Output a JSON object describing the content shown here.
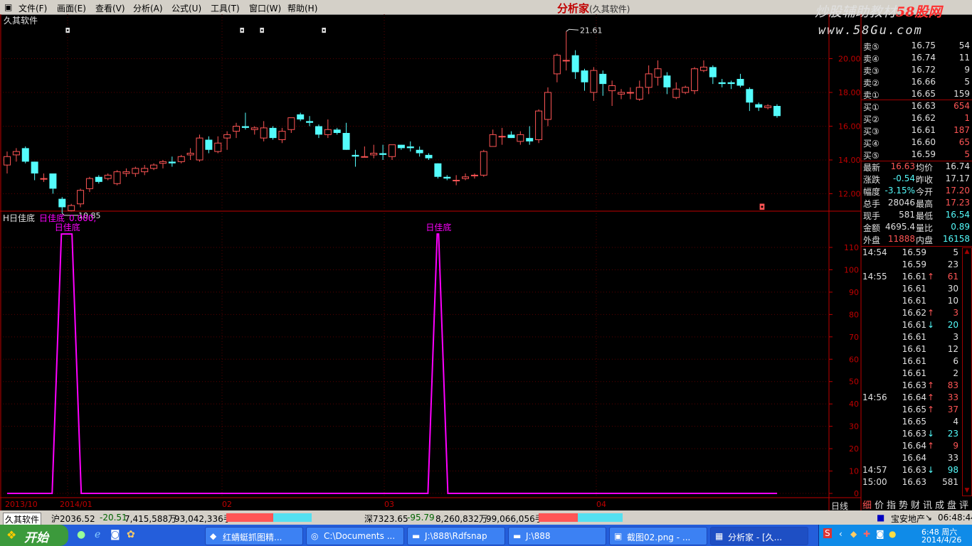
{
  "menu": {
    "items": [
      "文件(F)",
      "画面(E)",
      "查看(V)",
      "分析(A)",
      "公式(U)",
      "工具(T)",
      "窗口(W)",
      "帮助(H)"
    ],
    "app_name": "分析家",
    "app_vendor": "(久其软件)"
  },
  "ad": {
    "title_prefix": "炒股辅助教材",
    "title_brand": "58股网",
    "url": "www.58Gu.com"
  },
  "chart": {
    "stock_name": "久其软件",
    "price_axis_ticks": [
      "20.00",
      "18.00",
      "16.00",
      "14.00",
      "12.00"
    ],
    "high_label": "21.61",
    "low_label": "10.85",
    "indicator_title": "H日佳底",
    "indicator_series_label": "日佳底",
    "indicator_value": "0.000,",
    "signal_label": "日佳底",
    "indicator_axis_ticks": [
      "110",
      "100",
      "90",
      "80",
      "70",
      "60",
      "50",
      "40",
      "30",
      "20",
      "10",
      "0"
    ],
    "date_labels": [
      "2013/10",
      "2014/01",
      "02",
      "03",
      "04"
    ],
    "period": "日线",
    "marker_glyph": "◘",
    "colors": {
      "up": "#ff5555",
      "down": "#54fcfc",
      "indicator": "#ff00ff",
      "axis": "#c00000"
    }
  },
  "chart_data": [
    {
      "type": "candlestick",
      "title": "久其软件",
      "ylim": [
        11,
        22
      ],
      "high_mark": 21.61,
      "low_mark": 10.85,
      "candles": [
        [
          13.7,
          14.5,
          13.2,
          14.2
        ],
        [
          14.3,
          14.7,
          13.9,
          14.5
        ],
        [
          14.7,
          14.8,
          13.8,
          13.9
        ],
        [
          13.9,
          13.9,
          12.8,
          13.2
        ],
        [
          12.9,
          13.2,
          12.7,
          12.9
        ],
        [
          13.2,
          13.2,
          12.0,
          12.3
        ],
        [
          11.7,
          11.8,
          10.85,
          11.2
        ],
        [
          11.0,
          11.4,
          10.95,
          11.3
        ],
        [
          11.4,
          12.3,
          11.2,
          12.2
        ],
        [
          12.3,
          13.0,
          12.1,
          12.9
        ],
        [
          13.0,
          13.1,
          12.6,
          12.7
        ],
        [
          12.9,
          13.2,
          12.8,
          13.1
        ],
        [
          12.6,
          13.4,
          12.5,
          13.3
        ],
        [
          13.2,
          13.5,
          13.0,
          13.3
        ],
        [
          13.2,
          13.6,
          13.0,
          13.5
        ],
        [
          13.3,
          13.7,
          13.1,
          13.5
        ],
        [
          13.5,
          13.8,
          13.4,
          13.7
        ],
        [
          13.8,
          14.0,
          13.5,
          13.9
        ],
        [
          13.9,
          14.2,
          13.6,
          13.8
        ],
        [
          13.9,
          14.3,
          13.8,
          14.2
        ],
        [
          14.3,
          14.7,
          14.0,
          14.4
        ],
        [
          14.0,
          15.5,
          13.9,
          15.3
        ],
        [
          15.2,
          15.4,
          14.4,
          14.6
        ],
        [
          14.5,
          15.4,
          14.4,
          15.0
        ],
        [
          15.3,
          15.7,
          14.6,
          15.5
        ],
        [
          15.7,
          16.2,
          15.3,
          16.0
        ],
        [
          16.0,
          16.8,
          15.8,
          15.9
        ],
        [
          15.8,
          16.0,
          15.5,
          15.9
        ],
        [
          15.3,
          16.3,
          15.1,
          15.9
        ],
        [
          15.9,
          16.0,
          15.2,
          15.3
        ],
        [
          15.2,
          15.9,
          15.0,
          15.7
        ],
        [
          15.8,
          16.5,
          15.6,
          16.5
        ],
        [
          16.7,
          16.8,
          16.3,
          16.4
        ],
        [
          16.3,
          16.6,
          16.0,
          16.2
        ],
        [
          16.0,
          16.1,
          15.3,
          15.5
        ],
        [
          15.5,
          16.4,
          15.3,
          15.8
        ],
        [
          15.8,
          15.9,
          15.5,
          15.6
        ],
        [
          15.6,
          16.2,
          14.6,
          14.6
        ],
        [
          14.3,
          14.6,
          13.6,
          14.2
        ],
        [
          14.2,
          14.8,
          14.2,
          14.2
        ],
        [
          14.3,
          14.9,
          14.1,
          14.4
        ],
        [
          14.4,
          14.9,
          14.0,
          14.3
        ],
        [
          14.2,
          14.9,
          14.0,
          14.9
        ],
        [
          14.9,
          14.9,
          14.6,
          14.7
        ],
        [
          14.8,
          15.1,
          14.5,
          14.7
        ],
        [
          14.6,
          14.8,
          14.2,
          14.4
        ],
        [
          14.3,
          14.4,
          14.0,
          14.1
        ],
        [
          13.8,
          13.8,
          12.9,
          13.0
        ],
        [
          13.0,
          13.1,
          12.8,
          12.9
        ],
        [
          12.8,
          13.1,
          12.5,
          12.8
        ],
        [
          12.9,
          13.2,
          12.8,
          13.0
        ],
        [
          13.1,
          13.2,
          12.9,
          13.1
        ],
        [
          13.1,
          14.6,
          13.0,
          14.5
        ],
        [
          14.8,
          15.8,
          14.8,
          15.5
        ],
        [
          15.4,
          15.9,
          14.9,
          15.4
        ],
        [
          15.5,
          15.7,
          15.3,
          15.3
        ],
        [
          15.1,
          15.7,
          14.9,
          15.5
        ],
        [
          15.3,
          16.0,
          14.9,
          15.1
        ],
        [
          15.2,
          17.0,
          15.0,
          16.9
        ],
        [
          16.4,
          18.3,
          16.0,
          18.0
        ],
        [
          19.1,
          20.3,
          18.6,
          20.2
        ],
        [
          19.9,
          21.61,
          19.3,
          19.9
        ],
        [
          20.2,
          20.5,
          18.8,
          19.2
        ],
        [
          19.3,
          19.4,
          18.1,
          18.6
        ],
        [
          18.0,
          19.5,
          17.5,
          19.3
        ],
        [
          19.1,
          19.3,
          17.8,
          18.5
        ],
        [
          18.1,
          18.7,
          17.2,
          18.4
        ],
        [
          17.9,
          18.2,
          17.6,
          18.0
        ],
        [
          18.0,
          18.3,
          17.6,
          18.0
        ],
        [
          17.6,
          18.7,
          17.5,
          18.3
        ],
        [
          18.3,
          19.6,
          17.9,
          19.1
        ],
        [
          18.9,
          19.9,
          18.4,
          19.4
        ],
        [
          19.0,
          19.2,
          17.9,
          18.3
        ],
        [
          17.7,
          18.6,
          17.6,
          18.2
        ],
        [
          18.0,
          18.4,
          17.9,
          18.3
        ],
        [
          18.1,
          19.5,
          17.9,
          19.4
        ],
        [
          19.3,
          19.9,
          19.2,
          19.5
        ],
        [
          19.5,
          19.6,
          18.5,
          18.9
        ],
        [
          18.6,
          18.8,
          18.3,
          18.5
        ],
        [
          18.6,
          18.7,
          18.2,
          18.5
        ],
        [
          18.8,
          19.1,
          18.3,
          18.4
        ],
        [
          18.2,
          18.3,
          16.9,
          17.4
        ],
        [
          17.3,
          17.4,
          16.9,
          17.1
        ],
        [
          17.1,
          17.3,
          17.0,
          17.2
        ],
        [
          17.2,
          17.3,
          16.5,
          16.6
        ]
      ]
    },
    {
      "type": "line",
      "title": "H日佳底",
      "series": [
        {
          "name": "日佳底",
          "values": [
            0,
            0,
            0,
            0,
            0,
            0,
            116,
            116,
            0,
            0,
            0,
            0,
            0,
            0,
            0,
            0,
            0,
            0,
            0,
            0,
            0,
            0,
            0,
            0,
            0,
            0,
            0,
            0,
            0,
            0,
            0,
            0,
            0,
            0,
            0,
            0,
            0,
            0,
            0,
            0,
            0,
            0,
            0,
            0,
            0,
            0,
            0,
            116,
            0,
            0,
            0,
            0,
            0,
            0,
            0,
            0,
            0,
            0,
            0,
            0,
            0,
            0,
            0,
            0,
            0,
            0,
            0,
            0,
            0,
            0,
            0,
            0,
            0,
            0,
            0,
            0,
            0,
            0,
            0,
            0,
            0,
            0,
            0,
            0,
            0
          ]
        }
      ],
      "ylim": [
        0,
        120
      ],
      "signal_days": [
        6,
        7,
        47
      ]
    }
  ],
  "quote": {
    "asks": [
      {
        "label": "卖⑤",
        "price": "16.75",
        "vol": "54"
      },
      {
        "label": "卖④",
        "price": "16.74",
        "vol": "11"
      },
      {
        "label": "卖③",
        "price": "16.72",
        "vol": "9"
      },
      {
        "label": "卖②",
        "price": "16.66",
        "vol": "5"
      },
      {
        "label": "卖①",
        "price": "16.65",
        "vol": "159"
      }
    ],
    "bids": [
      {
        "label": "买①",
        "price": "16.63",
        "vol": "654"
      },
      {
        "label": "买②",
        "price": "16.62",
        "vol": "1"
      },
      {
        "label": "买③",
        "price": "16.61",
        "vol": "187"
      },
      {
        "label": "买④",
        "price": "16.60",
        "vol": "65"
      },
      {
        "label": "买⑤",
        "price": "16.59",
        "vol": "5"
      }
    ],
    "stats": [
      {
        "l1": "最新",
        "v1": "16.63",
        "c1": "#ff5555",
        "l2": "均价",
        "v2": "16.74",
        "c2": "#e0e0e0"
      },
      {
        "l1": "涨跌",
        "v1": "-0.54",
        "c1": "#54fcfc",
        "l2": "昨收",
        "v2": "17.17",
        "c2": "#e0e0e0"
      },
      {
        "l1": "幅度",
        "v1": "-3.15%",
        "c1": "#54fcfc",
        "l2": "今开",
        "v2": "17.20",
        "c2": "#ff5555"
      },
      {
        "l1": "总手",
        "v1": "28046",
        "c1": "#e0e0e0",
        "l2": "最高",
        "v2": "17.23",
        "c2": "#ff5555"
      },
      {
        "l1": "现手",
        "v1": "581",
        "c1": "#e0e0e0",
        "l2": "最低",
        "v2": "16.54",
        "c2": "#54fcfc"
      },
      {
        "l1": "金额",
        "v1": "4695.4",
        "c1": "#e0e0e0",
        "l2": "量比",
        "v2": "0.89",
        "c2": "#54fcfc"
      },
      {
        "l1": "外盘",
        "v1": "11888",
        "c1": "#ff5555",
        "l2": "内盘",
        "v2": "16158",
        "c2": "#54fcfc"
      }
    ],
    "ticks": [
      {
        "time": "14:54",
        "price": "16.59",
        "dir": "",
        "vol": "5"
      },
      {
        "time": "",
        "price": "16.59",
        "dir": "",
        "vol": "23"
      },
      {
        "time": "14:55",
        "price": "16.61",
        "dir": "up",
        "vol": "61"
      },
      {
        "time": "",
        "price": "16.61",
        "dir": "",
        "vol": "30"
      },
      {
        "time": "",
        "price": "16.61",
        "dir": "",
        "vol": "10"
      },
      {
        "time": "",
        "price": "16.62",
        "dir": "up",
        "vol": "3"
      },
      {
        "time": "",
        "price": "16.61",
        "dir": "down",
        "vol": "20"
      },
      {
        "time": "",
        "price": "16.61",
        "dir": "",
        "vol": "3"
      },
      {
        "time": "",
        "price": "16.61",
        "dir": "",
        "vol": "12"
      },
      {
        "time": "",
        "price": "16.61",
        "dir": "",
        "vol": "6"
      },
      {
        "time": "",
        "price": "16.61",
        "dir": "",
        "vol": "2"
      },
      {
        "time": "",
        "price": "16.63",
        "dir": "up",
        "vol": "83"
      },
      {
        "time": "14:56",
        "price": "16.64",
        "dir": "up",
        "vol": "33"
      },
      {
        "time": "",
        "price": "16.65",
        "dir": "up",
        "vol": "37"
      },
      {
        "time": "",
        "price": "16.65",
        "dir": "",
        "vol": "4"
      },
      {
        "time": "",
        "price": "16.63",
        "dir": "down",
        "vol": "23"
      },
      {
        "time": "",
        "price": "16.64",
        "dir": "up",
        "vol": "9"
      },
      {
        "time": "",
        "price": "16.64",
        "dir": "",
        "vol": "33"
      },
      {
        "time": "14:57",
        "price": "16.63",
        "dir": "down",
        "vol": "98"
      },
      {
        "time": "15:00",
        "price": "16.63",
        "dir": "",
        "vol": "581"
      }
    ],
    "tabs": [
      "细",
      "价",
      "指",
      "势",
      "财",
      "讯",
      "成",
      "盘",
      "评"
    ]
  },
  "status": {
    "name": "久其软件",
    "sh_index": "沪2036.52",
    "sh_change": "-20.51",
    "sh_amount": "7,415,588万",
    "sh_volume": "93,042,336手",
    "sz_index": "深7323.65",
    "sz_change": "-95.79",
    "sz_amount": "8,260,832万",
    "sz_volume": "99,066,056手",
    "sector": "宝安地产",
    "time": "06:48:44"
  },
  "taskbar": {
    "start": "开始",
    "tasks": [
      "红蜻蜓抓图精...",
      "C:\\Documents ...",
      "J:\\888\\Rdfsnap",
      "J:\\888",
      "截图02.png - ...",
      "分析家 - [久..."
    ],
    "clock_time": "6:48 周六",
    "clock_date": "2014/4/26"
  }
}
